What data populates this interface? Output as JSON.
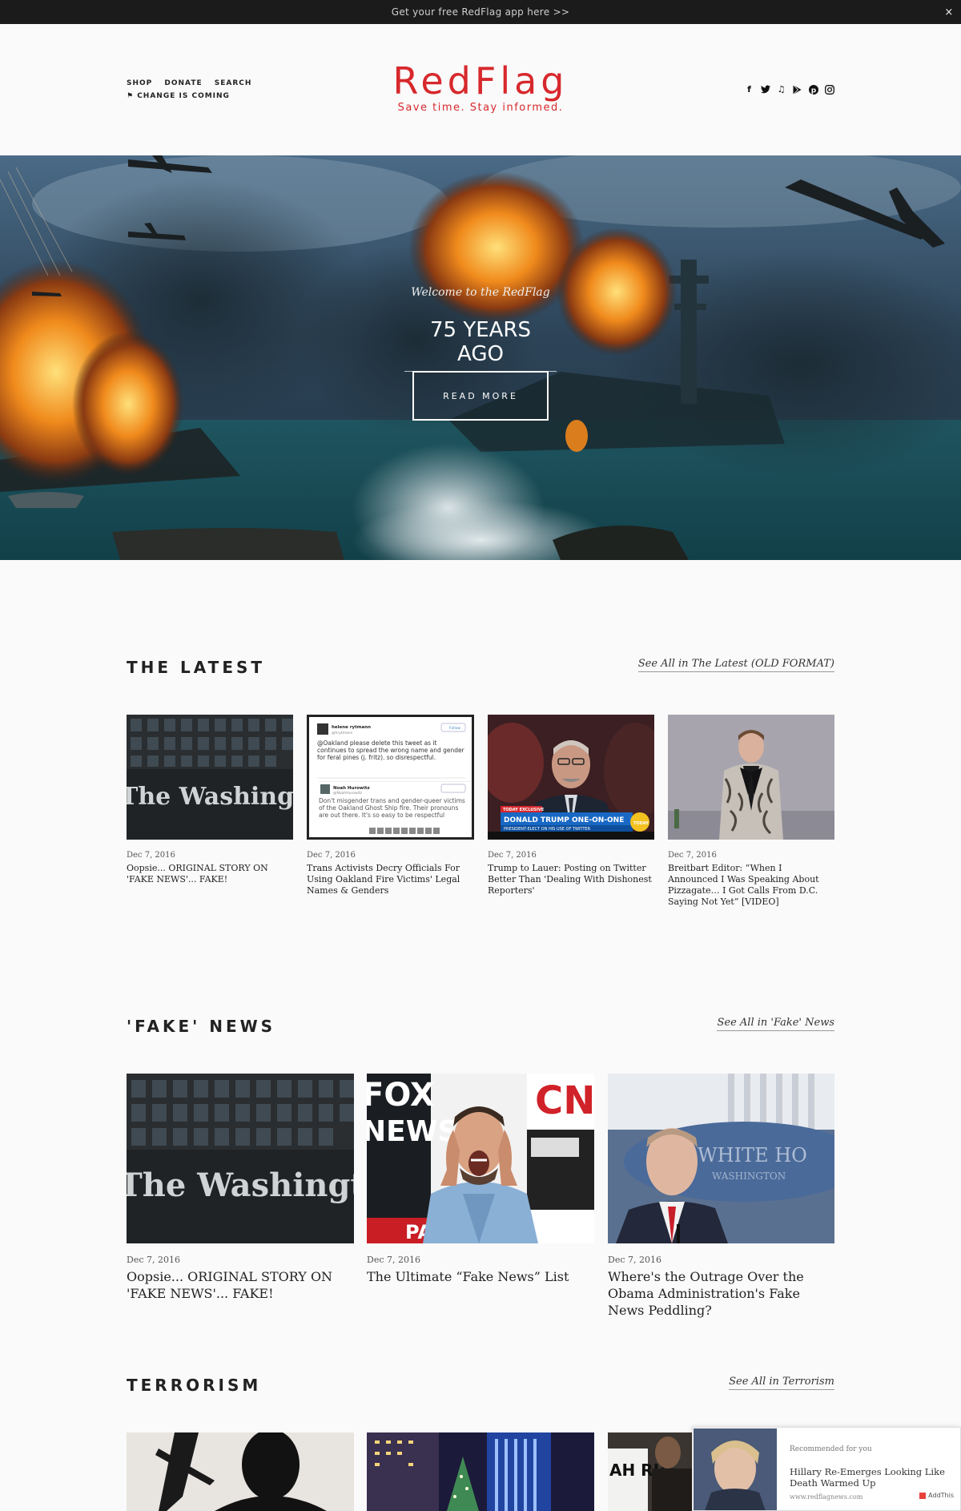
{
  "announcement": {
    "text": "Get your free RedFlag app here >>",
    "close": "×"
  },
  "nav": {
    "items": [
      "SHOP",
      "DONATE",
      "SEARCH"
    ],
    "secondary": "⚑ CHANGE IS COMING"
  },
  "brand": {
    "name": "RedFlag",
    "tagline": "Save time. Stay informed.",
    "color": "#d7282c"
  },
  "social": [
    "facebook-icon",
    "twitter-icon",
    "music-icon",
    "google-play-icon",
    "pinterest-icon",
    "instagram-icon"
  ],
  "social_glyphs": [
    "f",
    "🐦",
    "♫",
    "▶",
    "Ⓟ",
    "◻"
  ],
  "hero": {
    "kicker": "Welcome to the RedFlag",
    "title": "75 YEARS AGO",
    "button": "READ MORE"
  },
  "sections": {
    "latest": {
      "title": "THE LATEST",
      "see_all": "See All in The Latest (OLD FORMAT)",
      "cards": [
        {
          "date": "Dec 7, 2016",
          "headline": "Oopsie... ORIGINAL STORY ON 'FAKE NEWS'... FAKE!",
          "image": "washington-post-building"
        },
        {
          "date": "Dec 7, 2016",
          "headline": "Trans Activists Decry Officials For Using Oakland Fire Victims' Legal Names & Genders",
          "image": "tweet-screenshot"
        },
        {
          "date": "Dec 7, 2016",
          "headline": "Trump to Lauer: Posting on Twitter Better Than 'Dealing With Dishonest Reporters'",
          "image": "today-show-anchor"
        },
        {
          "date": "Dec 7, 2016",
          "headline": "Breitbart Editor: “When I Announced I Was Speaking About Pizzagate… I Got Calls From D.C. Saying Not Yet” [VIDEO]",
          "image": "speaker-on-stage"
        }
      ],
      "tweet": {
        "user1": "helene rytmann",
        "handle1": "@hrytmann",
        "text1": "@Oakland please delete this tweet as it continues to spread the wrong name and gender for feral pines (j. fritz). so disrespectful.",
        "follow": "Follow",
        "user2": "Noah Hurowitz",
        "handle2": "@NoahHurowitz",
        "text2": "Don't misgender trans and gender-queer victims of the Oakland Ghost Ship fire. Their pronouns are out there. It's so easy to be respectful"
      },
      "tv": {
        "banner": "TODAY EXCLUSIVE",
        "lower_third": "DONALD TRUMP ONE-ON-ONE",
        "sub": "PRESIDENT-ELECT ON HIS USE OF TWITTER",
        "logo": "TODAY"
      }
    },
    "fake": {
      "title": "'FAKE' NEWS",
      "see_all": "See All in 'Fake' News",
      "cards": [
        {
          "date": "Dec 7, 2016",
          "headline": "Oopsie... ORIGINAL STORY ON 'FAKE NEWS'... FAKE!",
          "image": "washington-post-building"
        },
        {
          "date": "Dec 7, 2016",
          "headline": "The Ultimate “Fake News” List",
          "image": "man-screaming-news-logos"
        },
        {
          "date": "Dec 7, 2016",
          "headline": "Where's the Outrage Over the Obama Administration's Fake News Peddling?",
          "image": "white-house-briefing"
        }
      ],
      "logos": {
        "fox": "FOX",
        "news": "NEWS",
        "cnn": "CN",
        "pa": "PA",
        "wh": "WHITE HO",
        "wash": "WASHINGTON"
      }
    },
    "terror": {
      "title": "TERRORISM",
      "see_all": "See All in Terrorism",
      "sign": "AH RUE"
    }
  },
  "masthead_text": "The Washington P",
  "recommended": {
    "label": "Recommended for you",
    "title": "Hillary Re-Emerges Looking Like Death Warmed Up",
    "url": "www.redflagnews.com",
    "badge": "AddThis"
  }
}
